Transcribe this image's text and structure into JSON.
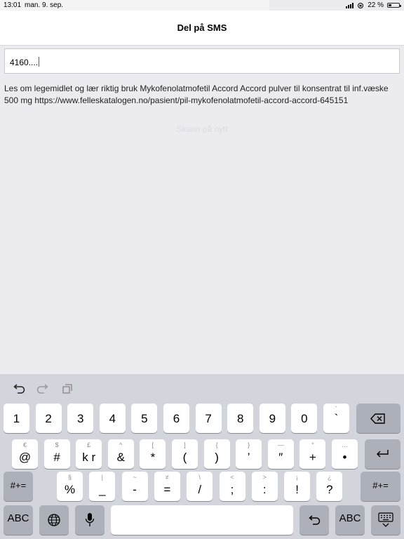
{
  "status_bar": {
    "time": "13:01",
    "date": "man. 9. sep.",
    "battery": "22 %"
  },
  "nav": {
    "title": "Del på SMS"
  },
  "input": {
    "value": "4160...."
  },
  "message": {
    "text": "Les om legemidlet og lær riktig bruk Mykofenolatmofetil Accord Accord pulver til konsentrat til inf.væske 500 mg https://www.felleskatalogen.no/pasient/pil-mykofenolatmofetil-accord-accord-645151"
  },
  "scan_again": "Skann på nytt",
  "keyboard": {
    "row1": [
      "1",
      "2",
      "3",
      "4",
      "5",
      "6",
      "7",
      "8",
      "9",
      "0",
      "`"
    ],
    "row1_sub": [
      "",
      "",
      "",
      "",
      "",
      "",
      "",
      "",
      "",
      "",
      "´"
    ],
    "row2": [
      "@",
      "#",
      "k r",
      "&",
      "*",
      "(",
      ")",
      "’",
      "″",
      "+",
      "•"
    ],
    "row2_sub": [
      "€",
      "$",
      "£",
      "^",
      "[",
      "]",
      "{",
      "}",
      "—",
      "°",
      "…"
    ],
    "row3": [
      "%",
      "_",
      "-",
      "=",
      "/",
      ";",
      ":",
      "!",
      "?"
    ],
    "row3_sub": [
      "§",
      "|",
      "~",
      "≠",
      "\\",
      "<",
      ">",
      "¡",
      "¿"
    ],
    "symbols_label": "#+=",
    "abc_label": "ABC"
  }
}
